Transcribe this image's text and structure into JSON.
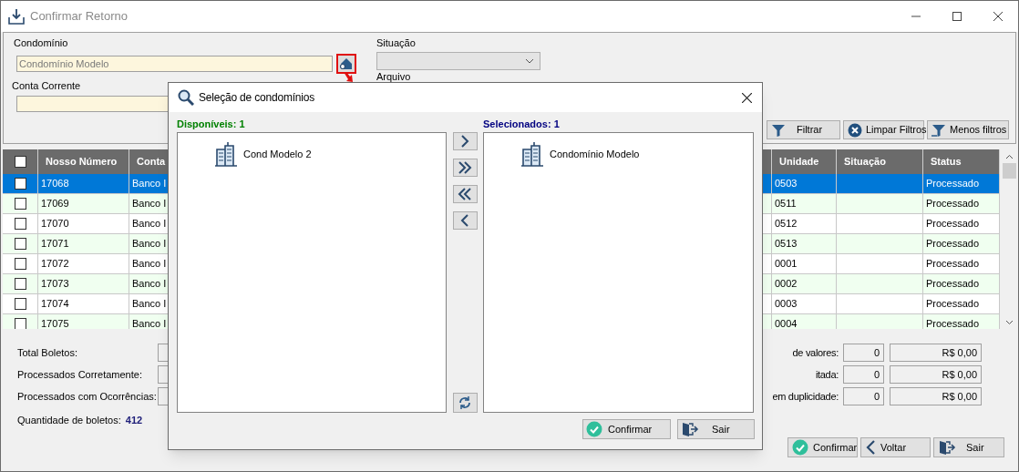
{
  "window": {
    "title": "Confirmar Retorno"
  },
  "filters": {
    "condominio_label": "Condomínio",
    "condominio_value": "Condomínio Modelo",
    "conta_corrente_label": "Conta Corrente",
    "situacao_label": "Situação",
    "arquivo_label": "Arquivo",
    "buttons": [
      {
        "kind": "filter",
        "label": "Filtrar"
      },
      {
        "kind": "clear",
        "label": "Limpar Filtros"
      },
      {
        "kind": "fewer",
        "label": "Menos filtros"
      }
    ]
  },
  "table": {
    "header_checked": false,
    "columns": [
      "Nosso Número",
      "Conta",
      "Unidade",
      "Situação",
      "Status"
    ],
    "rows": [
      {
        "checked": false,
        "selected": true,
        "nosso_numero": "17068",
        "conta": "Banco I",
        "unidade": "0503",
        "status": "Processado"
      },
      {
        "checked": false,
        "selected": false,
        "nosso_numero": "17069",
        "conta": "Banco I",
        "unidade": "0511",
        "status": "Processado"
      },
      {
        "checked": false,
        "selected": false,
        "nosso_numero": "17070",
        "conta": "Banco I",
        "unidade": "0512",
        "status": "Processado"
      },
      {
        "checked": false,
        "selected": false,
        "nosso_numero": "17071",
        "conta": "Banco I",
        "unidade": "0513",
        "status": "Processado"
      },
      {
        "checked": false,
        "selected": false,
        "nosso_numero": "17072",
        "conta": "Banco I",
        "unidade": "0001",
        "status": "Processado"
      },
      {
        "checked": false,
        "selected": false,
        "nosso_numero": "17073",
        "conta": "Banco I",
        "unidade": "0002",
        "status": "Processado"
      },
      {
        "checked": false,
        "selected": false,
        "nosso_numero": "17074",
        "conta": "Banco I",
        "unidade": "0003",
        "status": "Processado"
      },
      {
        "checked": false,
        "selected": false,
        "nosso_numero": "17075",
        "conta": "Banco I",
        "unidade": "0004",
        "status": "Processado"
      }
    ]
  },
  "summary": {
    "left": [
      "Total Boletos:",
      "Processados Corretamente:",
      "Processados com Ocorrências:"
    ],
    "quantidade_label": "Quantidade de boletos:",
    "quantidade_value": "412",
    "right": [
      {
        "label": "de valores:",
        "count": "0",
        "amount": "R$ 0,00"
      },
      {
        "label": "itada:",
        "count": "0",
        "amount": "R$ 0,00"
      },
      {
        "label": "em duplicidade:",
        "count": "0",
        "amount": "R$ 0,00"
      }
    ]
  },
  "actions": [
    {
      "kind": "confirm",
      "label": "Confirmar"
    },
    {
      "kind": "back",
      "label": "Voltar"
    },
    {
      "kind": "exit",
      "label": "Sair"
    }
  ],
  "dialog": {
    "title": "Seleção de condomínios",
    "available_label": "Disponíveis: 1",
    "selected_label": "Selecionados: 1",
    "available": [
      "Cond Modelo 2"
    ],
    "selected_items": [
      "Condomínio Modelo"
    ],
    "move_buttons": [
      {
        "kind": "add"
      },
      {
        "kind": "add-all"
      },
      {
        "kind": "remove-all"
      },
      {
        "kind": "remove"
      }
    ],
    "buttons": [
      {
        "kind": "confirm",
        "label": "Confirmar"
      },
      {
        "kind": "exit",
        "label": "Sair"
      }
    ]
  }
}
